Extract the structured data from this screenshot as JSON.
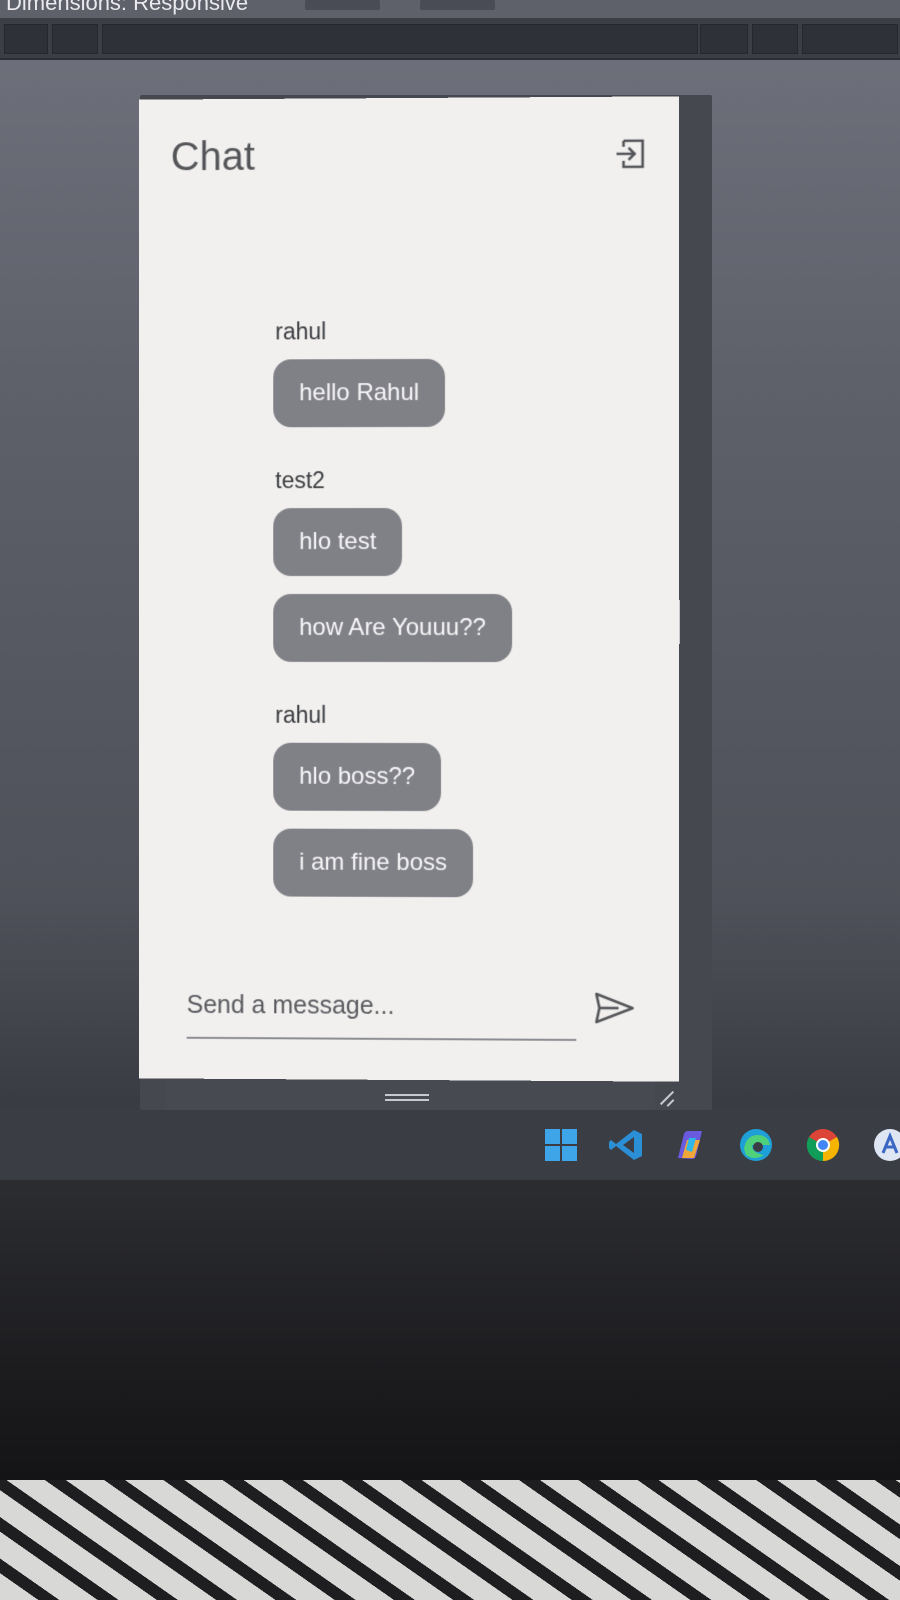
{
  "devtools": {
    "dimensions_label": "Dimensions: Responsive"
  },
  "app": {
    "title": "Chat",
    "logout_icon": "logout-icon"
  },
  "messages": [
    {
      "sender": "rahul",
      "texts": [
        "hello Rahul"
      ]
    },
    {
      "sender": "test2",
      "texts": [
        "hlo test",
        "how Are Youuu??"
      ]
    },
    {
      "sender": "rahul",
      "texts": [
        "hlo boss??",
        "i am fine boss"
      ]
    }
  ],
  "composer": {
    "placeholder": "Send a message...",
    "send_icon": "send-icon"
  },
  "colors": {
    "bubble": "#808087",
    "screen_bg": "#f1f0ee"
  },
  "taskbar": {
    "icons": [
      "windows-start-icon",
      "vscode-icon",
      "copilot-icon",
      "edge-icon",
      "chrome-icon",
      "app-icon"
    ]
  }
}
